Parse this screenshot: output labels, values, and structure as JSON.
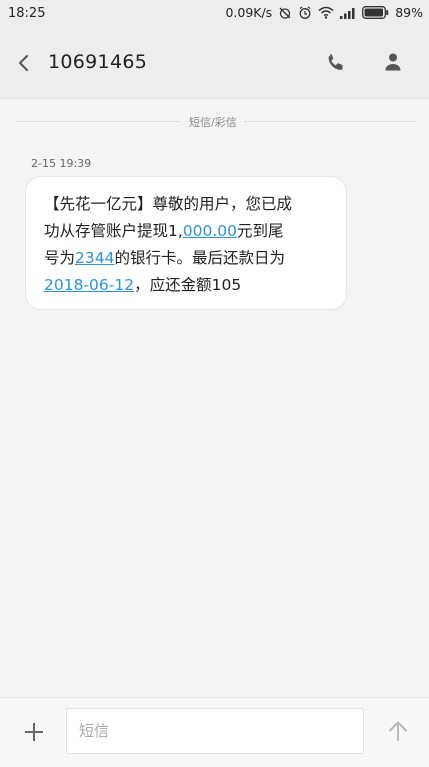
{
  "status_bar": {
    "time": "18:25",
    "network_speed": "0.09K/s",
    "battery_percent": "89%",
    "icons": [
      "alarm-off-icon",
      "alarm-clock-icon",
      "wifi-icon",
      "cellular-signal-icon",
      "battery-icon"
    ]
  },
  "header": {
    "contact": "10691465",
    "icons": [
      "back-arrow-icon",
      "phone-call-icon",
      "contact-person-icon"
    ]
  },
  "thread": {
    "divider_label": "短信/彩信",
    "message": {
      "timestamp": "2-15 19:39",
      "lines": [
        {
          "parts": [
            {
              "text": "【先花一亿元】尊敬的用户，您已成"
            }
          ]
        },
        {
          "parts": [
            {
              "text": "功从存管账户提现1,"
            },
            {
              "text": "000.00",
              "link": true
            },
            {
              "text": "元到尾"
            }
          ]
        },
        {
          "parts": [
            {
              "text": "号为"
            },
            {
              "text": "2344",
              "link": true
            },
            {
              "text": "的银行卡。最后还款日为"
            }
          ]
        },
        {
          "parts": [
            {
              "text": "2018-06-12",
              "link": true
            },
            {
              "text": "，应还金额105"
            }
          ]
        }
      ]
    }
  },
  "composer": {
    "placeholder": "短信",
    "value": "",
    "icons": [
      "add-attachment-icon",
      "send-arrow-icon"
    ]
  },
  "colors": {
    "link": "#2e94d6",
    "background": "#f4f4f4",
    "header_background": "#ededed",
    "bubble_background": "#ffffff"
  }
}
